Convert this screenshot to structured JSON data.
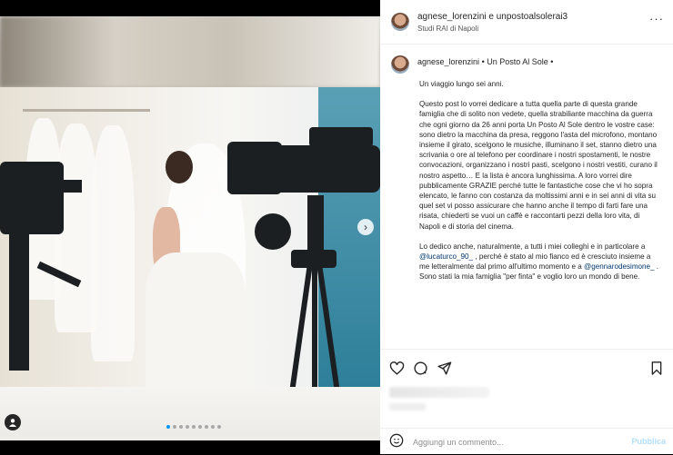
{
  "post": {
    "image_alt": "Bride in wedding dress standing between film cameras on a set",
    "carousel_dots": 9,
    "carousel_active": 0,
    "next_icon": "chevron-right-icon"
  },
  "header": {
    "username": "agnese_lorenzini e unpostoalsolerai3",
    "location": "Studi RAI di Napoli",
    "more": "···"
  },
  "caption": {
    "username": "agnese_lorenzini",
    "meta": " • Un Posto Al Sole •",
    "paragraphs": [
      "Un viaggio lungo sei anni.",
      "Questo post lo vorrei dedicare a tutta quella parte di questa grande famiglia che di solito non vedete, quella strabiliante macchina da guerra che ogni giorno da 26 anni porta Un Posto Al Sole dentro le vostre case: sono dietro la macchina da presa, reggono l'asta del microfono, montano insieme il girato, scelgono le musiche, illuminano il set, stanno dietro una scrivania o ore al telefono per coordinare i nostri spostamenti, le nostre convocazioni, organizzano i nostri pasti, scelgono i nostri vestiti, curano il nostro aspetto… E la lista è ancora lunghissima. A loro vorrei dire pubblicamente GRAZIE perché tutte le fantastiche cose che vi ho sopra elencato, le fanno con costanza da moltissimi anni e in sei anni di vita su quel set vi posso assicurare che hanno anche il tempo di farti fare una risata, chiederti se vuoi un caffè e raccontarti pezzi della loro vita, di Napoli e di storia del cinema."
    ],
    "p3_before": "Lo dedico anche, naturalmente, a tutti i miei colleghi e in particolare a ",
    "mention1": "@lucaturco_90_",
    "p3_middle": " , perché è stato al mio fianco ed è cresciuto insieme a me letteralmente dal primo all'ultimo momento e a ",
    "mention2": "@gennarodesimone_",
    "p3_after": " . Sono stati la mia famiglia \"per finta\" e voglio loro un mondo di bene."
  },
  "actions": {
    "like_icon": "heart-icon",
    "comment_icon": "comment-icon",
    "share_icon": "share-icon",
    "save_icon": "bookmark-icon"
  },
  "comment": {
    "placeholder": "Aggiungi un commento...",
    "publish": "Pubblica",
    "emoji_icon": "smiley-icon"
  },
  "colors": {
    "accent": "#0095f6",
    "publish_disabled": "#b2dffc",
    "mention": "#00376b"
  }
}
